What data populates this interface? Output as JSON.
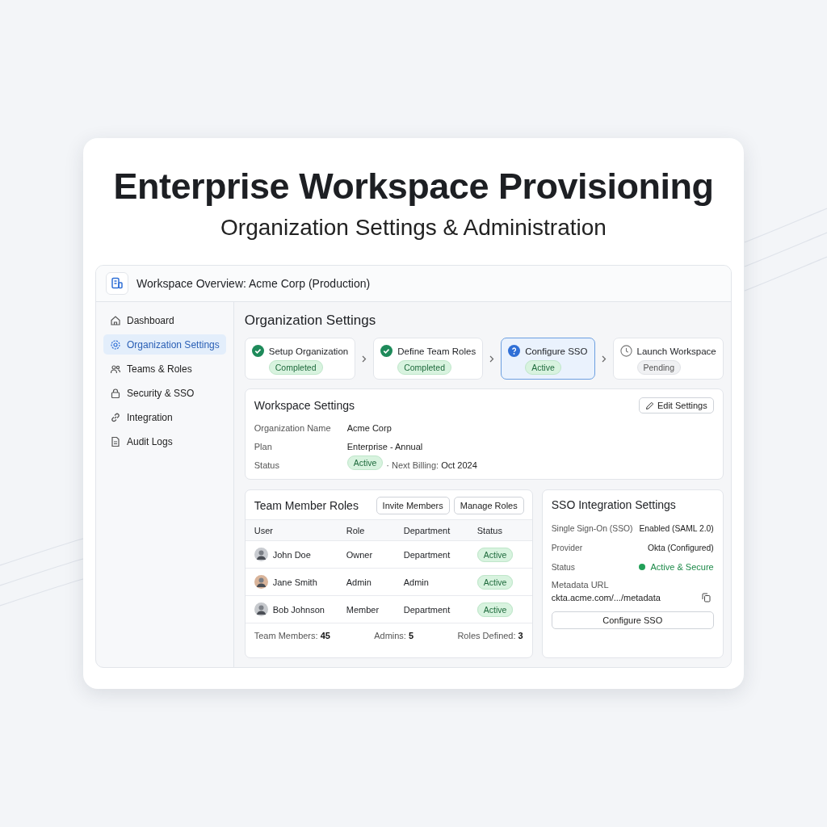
{
  "hero": {
    "title": "Enterprise Workspace Provisioning",
    "subtitle": "Organization Settings & Administration"
  },
  "window": {
    "title": "Workspace Overview: Acme Corp (Production)"
  },
  "sidebar": {
    "items": [
      {
        "label": "Dashboard",
        "selected": false
      },
      {
        "label": "Organization Settings",
        "selected": true
      },
      {
        "label": "Teams & Roles",
        "selected": false
      },
      {
        "label": "Security & SSO",
        "selected": false
      },
      {
        "label": "Integration",
        "selected": false
      },
      {
        "label": "Audit Logs",
        "selected": false
      }
    ]
  },
  "page_title": "Organization Settings",
  "steps": [
    {
      "label": "Setup Organization",
      "status": "Completed",
      "kind": "completed",
      "selected": false
    },
    {
      "label": "Define Team Roles",
      "status": "Completed",
      "kind": "completed",
      "selected": false
    },
    {
      "label": "Configure SSO",
      "status": "Active",
      "kind": "active",
      "selected": true
    },
    {
      "label": "Launch Workspace",
      "status": "Pending",
      "kind": "pending",
      "selected": false
    }
  ],
  "workspace_settings": {
    "title": "Workspace Settings",
    "edit_button": "Edit Settings",
    "fields": [
      {
        "label": "Organization Name",
        "value": "Acme Corp"
      },
      {
        "label": "Plan",
        "value": "Enterprise - Annual"
      },
      {
        "label": "Status",
        "badge": "Active",
        "note": "· Next Billing: **Oct 2024**"
      }
    ]
  },
  "team": {
    "title": "Team Member Roles",
    "buttons": [
      "Invite Members",
      "Manage Roles"
    ],
    "columns": [
      "User",
      "Role",
      "Department",
      "Status"
    ],
    "rows": [
      {
        "user": "John Doe",
        "role": "Owner",
        "department": "Department",
        "status": "Active"
      },
      {
        "user": "Jane Smith",
        "role": "Admin",
        "department": "Admin",
        "status": "Active"
      },
      {
        "user": "Bob Johnson",
        "role": "Member",
        "department": "Department",
        "status": "Active"
      }
    ],
    "footer": [
      "Team Members: **45**",
      "Admins: **5**",
      "Roles Defined: **3**"
    ]
  },
  "sso": {
    "title": "SSO Integration Settings",
    "rows": [
      {
        "label": "Single Sign-On (SSO)",
        "value": "Enabled (SAML 2.0)",
        "kind": "text"
      },
      {
        "label": "Provider",
        "value": "Okta (Configured)",
        "kind": "text"
      },
      {
        "label": "Status",
        "value": "Active & Secure",
        "kind": "status"
      }
    ],
    "metadata_label": "Metadata URL",
    "metadata_url": "ckta.acme.com/.../metadata",
    "button": "Configure SSO"
  }
}
